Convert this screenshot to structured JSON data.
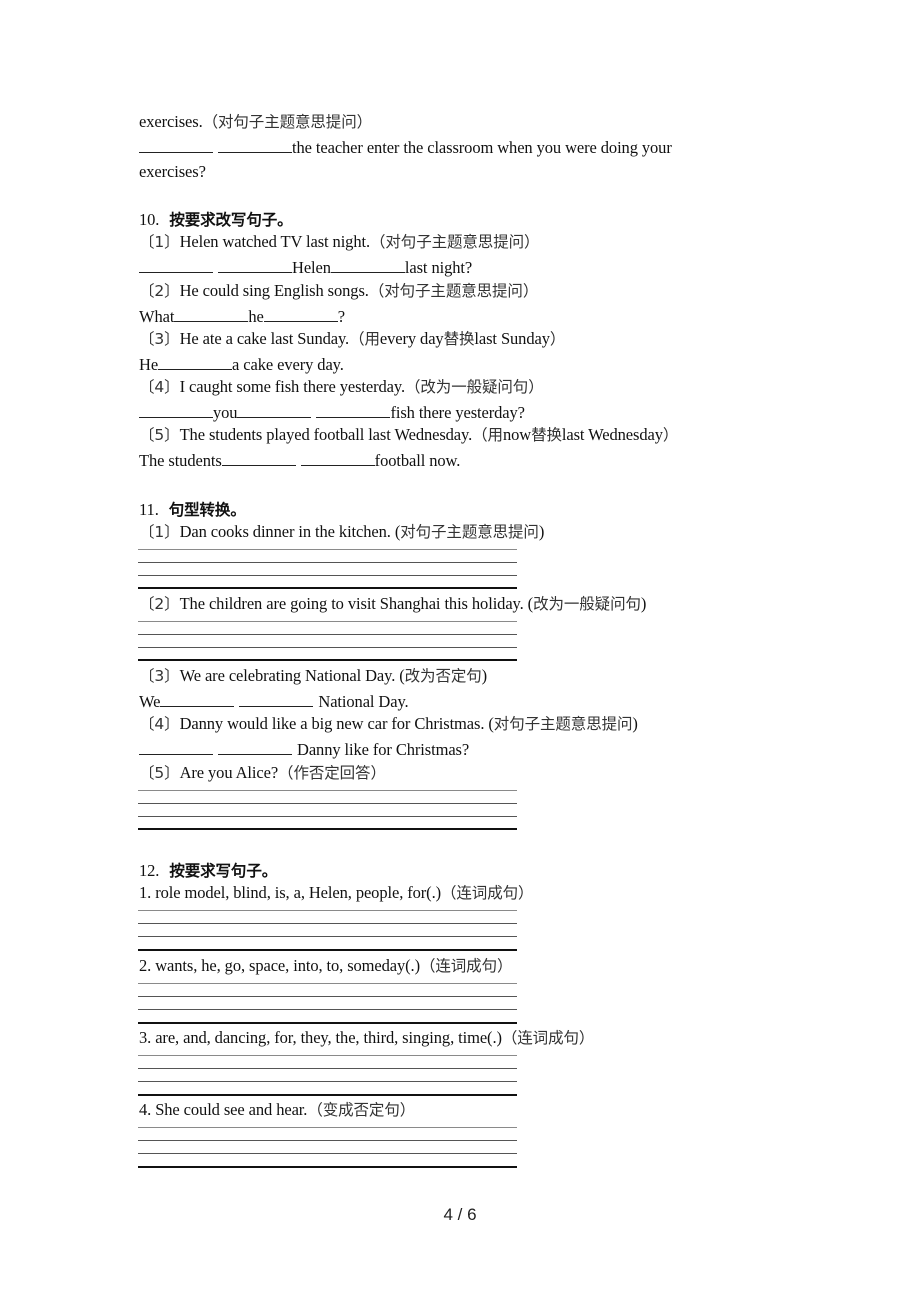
{
  "document": {
    "page_number": "4 / 6",
    "continued": {
      "line1_en": "exercises.",
      "line1_cn": "（对句子主题意思提问）",
      "line2_after_blanks": "the teacher enter the classroom when you were doing your",
      "line3": "exercises?"
    },
    "section10": {
      "number": "10.",
      "title": "按要求改写句子。",
      "items": [
        {
          "label": "〔1〕",
          "sentence": "Helen watched TV last night.",
          "instruction": "（对句子主题意思提问）",
          "answer_parts": [
            "",
            " ",
            "Helen",
            "last night?"
          ]
        },
        {
          "label": "〔2〕",
          "sentence": "He could sing English songs.",
          "instruction": "（对句子主题意思提问）",
          "answer_parts": [
            "What",
            "he",
            "?"
          ]
        },
        {
          "label": "〔3〕",
          "sentence": "He ate a cake last Sunday.",
          "instruction_pre": "（用",
          "instruction_en1": "every day",
          "instruction_mid": "替换",
          "instruction_en2": "last Sunday",
          "instruction_post": "）",
          "answer_parts": [
            "He",
            "a cake every day."
          ]
        },
        {
          "label": "〔4〕",
          "sentence": "I caught some fish there yesterday.",
          "instruction": "（改为一般疑问句）",
          "answer_parts": [
            "you",
            "fish there yesterday?"
          ]
        },
        {
          "label": "〔5〕",
          "sentence": "The students played football last Wednesday.",
          "instruction_pre": "（用",
          "instruction_en1": "now",
          "instruction_mid": "替换",
          "instruction_en2": "last Wednesday",
          "instruction_post": "）",
          "answer_parts": [
            "The students",
            "football now."
          ]
        }
      ]
    },
    "section11": {
      "number": "11.",
      "title": "句型转换。",
      "items": [
        {
          "label": "〔1〕",
          "sentence": "Dan cooks dinner in the kitchen. (",
          "instruction": "对句子主题意思提问",
          "close": ")"
        },
        {
          "label": "〔2〕",
          "sentence": "The children are going to visit Shanghai this holiday. (",
          "instruction": "改为一般疑问句",
          "close": ")"
        },
        {
          "label": "〔3〕",
          "sentence": "We are celebrating National Day. (",
          "instruction": "改为否定句",
          "close": ")",
          "answer_parts": [
            "We",
            "National Day."
          ]
        },
        {
          "label": "〔4〕",
          "sentence": "Danny would like a big new car for Christmas. (",
          "instruction": "对句子主题意思提问",
          "close": ")",
          "answer_parts": [
            "Danny like for Christmas?"
          ]
        },
        {
          "label": "〔5〕",
          "sentence": "Are you Alice?",
          "instruction": "（作否定回答）"
        }
      ]
    },
    "section12": {
      "number": "12.",
      "title": "按要求写句子。",
      "items": [
        {
          "sentence": "1. role model, blind, is, a, Helen, people, for(.)",
          "instruction": "（连词成句）"
        },
        {
          "sentence": "2. wants, he, go, space, into, to, someday(.)",
          "instruction": "（连词成句）"
        },
        {
          "sentence": "3. are, and, dancing, for, they, the, third, singing, time(.)",
          "instruction": "（连词成句）"
        },
        {
          "sentence": "4. She could see and hear.",
          "instruction": "（变成否定句）"
        }
      ]
    }
  }
}
